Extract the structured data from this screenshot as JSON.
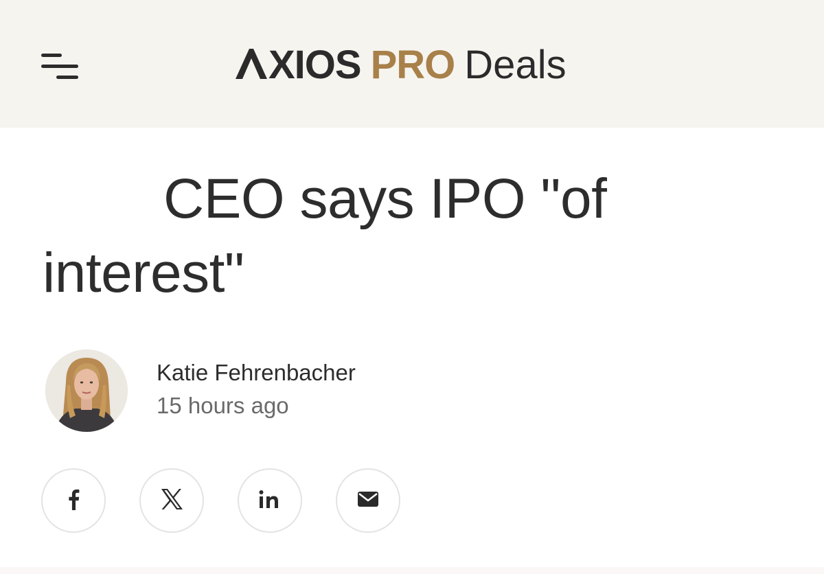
{
  "header": {
    "brand_axios": "XIOS",
    "brand_pro": "PRO",
    "brand_section": "Deals",
    "colors": {
      "background": "#f6f4ef",
      "brand_dark": "#2b2b2b",
      "brand_gold": "#a8804a"
    },
    "menu_icon": "hamburger-menu-icon"
  },
  "article": {
    "headline": "CEO says IPO \"of interest\"",
    "author": "Katie Fehrenbacher",
    "timestamp": "15 hours ago"
  },
  "share": {
    "buttons": [
      {
        "icon": "facebook-icon",
        "glyph": "f"
      },
      {
        "icon": "x-twitter-icon",
        "glyph": "𝕏"
      },
      {
        "icon": "linkedin-icon",
        "glyph": "in"
      },
      {
        "icon": "email-icon",
        "glyph": ""
      }
    ]
  }
}
